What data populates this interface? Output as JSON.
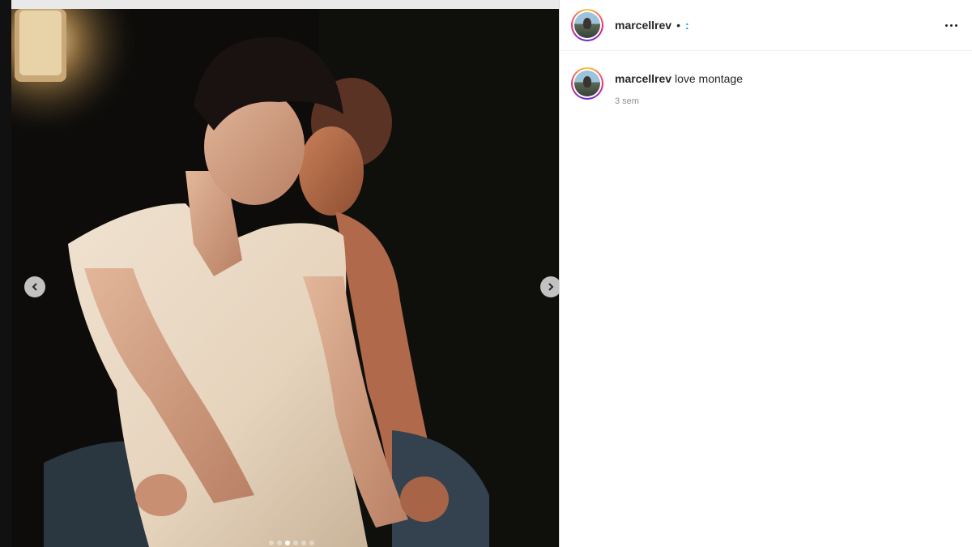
{
  "post": {
    "author": "marcellrev",
    "separator": "•",
    "follow_label": ":",
    "more_icon": "more-horizontal-icon",
    "caption_text": "love montage",
    "timestamp": "3 sem"
  },
  "carousel": {
    "prev_icon": "chevron-left-icon",
    "next_icon": "chevron-right-icon",
    "slide_count": 6,
    "active_index": 2
  },
  "colors": {
    "link": "#0095f6",
    "text": "#262626",
    "muted": "#8e8e8e"
  }
}
